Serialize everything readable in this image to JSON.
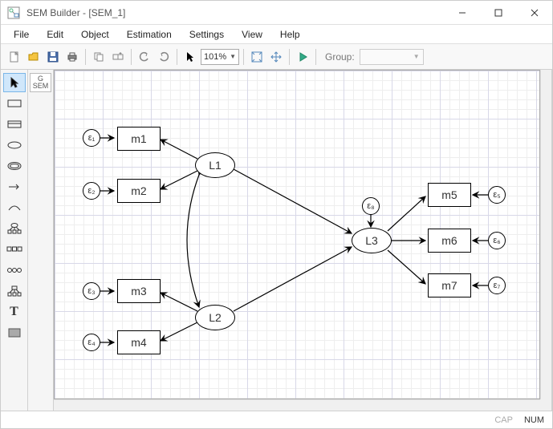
{
  "window": {
    "title": "SEM Builder - [SEM_1]"
  },
  "menu": {
    "file": "File",
    "edit": "Edit",
    "object": "Object",
    "estimation": "Estimation",
    "settings": "Settings",
    "view": "View",
    "help": "Help"
  },
  "toolbar": {
    "zoom": "101%",
    "group_label": "Group:",
    "group_value": ""
  },
  "palette": {
    "gsem_label_line1": "G",
    "gsem_label_line2": "SEM"
  },
  "diagram": {
    "latent": {
      "L1": "L1",
      "L2": "L2",
      "L3": "L3"
    },
    "observed": {
      "m1": "m1",
      "m2": "m2",
      "m3": "m3",
      "m4": "m4",
      "m5": "m5",
      "m6": "m6",
      "m7": "m7"
    },
    "errors": {
      "e1": "ε₁",
      "e2": "ε₂",
      "e3": "ε₃",
      "e4": "ε₄",
      "e5": "ε₅",
      "e6": "ε₆",
      "e7": "ε₇",
      "e8": "ε₈"
    }
  },
  "status": {
    "cap": "CAP",
    "num": "NUM"
  }
}
